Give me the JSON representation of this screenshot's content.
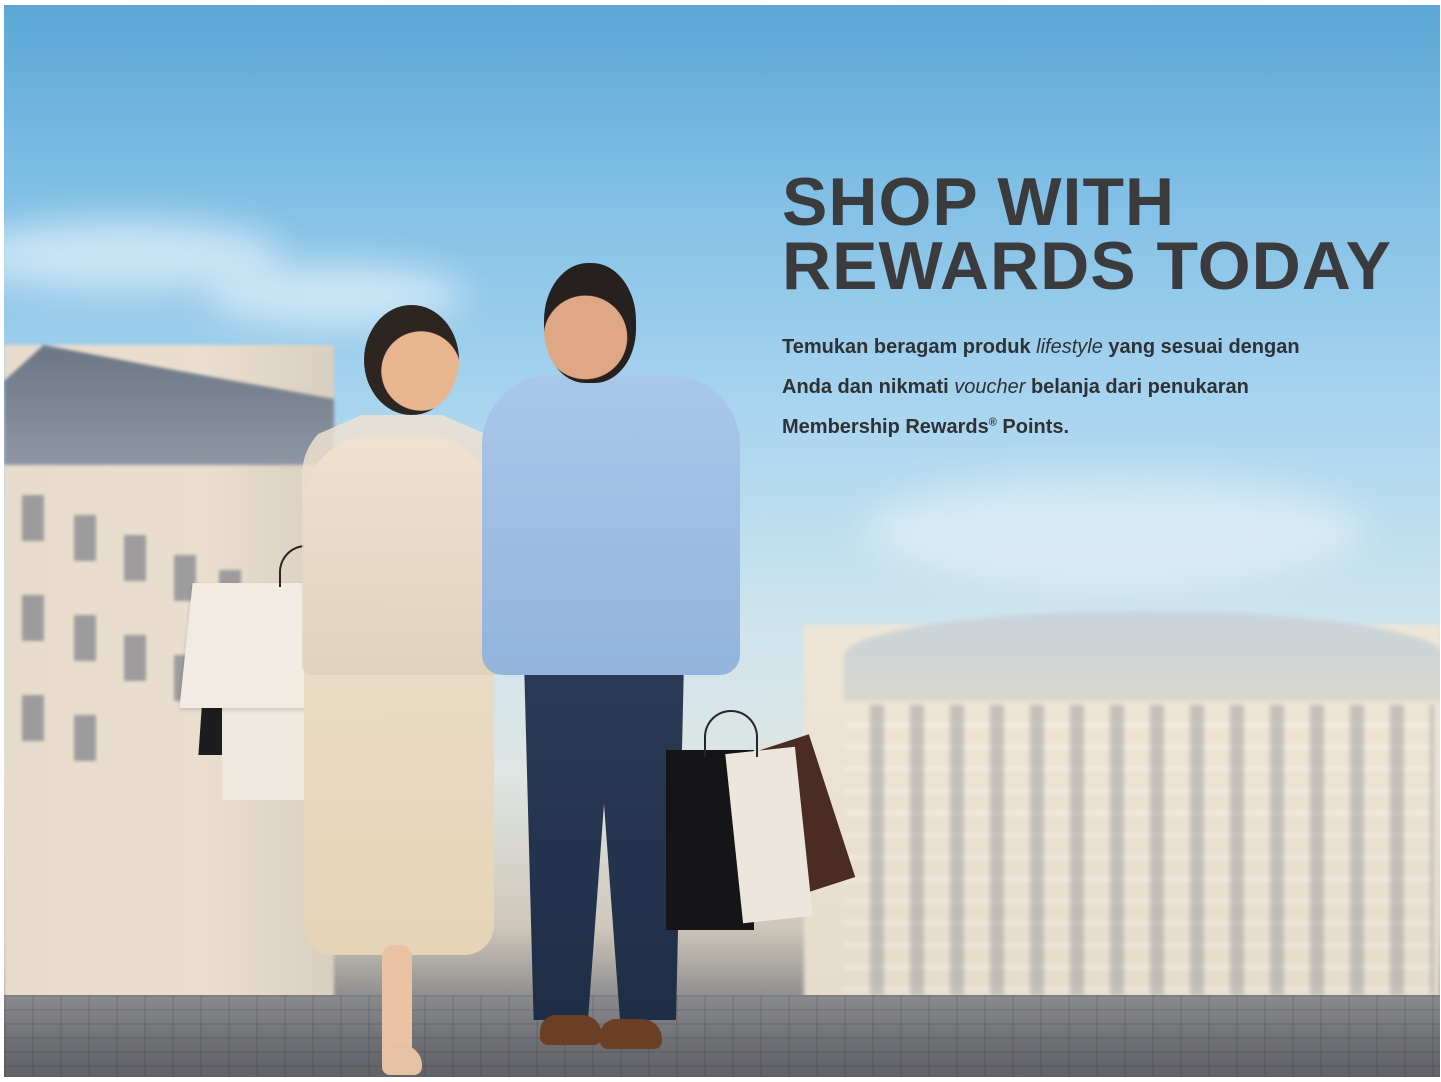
{
  "hero": {
    "headline_line1": "SHOP WITH",
    "headline_line2": "REWARDS TODAY",
    "body": {
      "part1": "Temukan beragam produk ",
      "emphasis1": "lifestyle",
      "part2": " yang sesuai dengan Anda dan nikmati ",
      "emphasis2": "voucher",
      "part3": " belanja dari penukaran Membership Rewards",
      "registered_mark": "®",
      "part4": " Points."
    }
  },
  "colors": {
    "headline": "#3b3b3d",
    "body": "#2f3135",
    "sky": "#82c0e6"
  }
}
